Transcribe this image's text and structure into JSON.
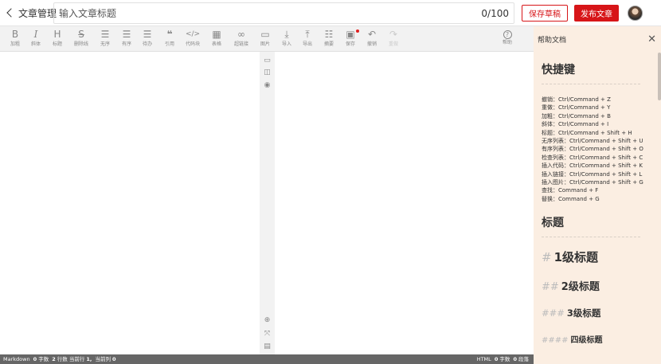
{
  "header": {
    "back_label": "文章管理",
    "title_placeholder": "输入文章标题",
    "title_value": "",
    "counter": "0/100",
    "save_draft_label": "保存草稿",
    "publish_label": "发布文章"
  },
  "toolbar": {
    "items": [
      {
        "glyph": "B",
        "label": "加粗"
      },
      {
        "glyph": "I",
        "label": "斜体"
      },
      {
        "glyph": "H",
        "label": "标题"
      },
      {
        "glyph": "S",
        "label": "删除线"
      },
      {
        "glyph": "☰",
        "label": "无序"
      },
      {
        "glyph": "☰",
        "label": "有序"
      },
      {
        "glyph": "☰",
        "label": "待办"
      },
      {
        "glyph": "❝",
        "label": "引用"
      },
      {
        "glyph": "</>",
        "label": "代码块"
      },
      {
        "glyph": "▦",
        "label": "表格"
      },
      {
        "glyph": "∞",
        "label": "超链接"
      },
      {
        "glyph": "▭",
        "label": "图片"
      },
      {
        "glyph": "⤓",
        "label": "导入"
      },
      {
        "glyph": "⤒",
        "label": "导出"
      },
      {
        "glyph": "☷",
        "label": "摘要"
      },
      {
        "glyph": "▣",
        "label": "保存"
      },
      {
        "glyph": "↶",
        "label": "撤销"
      },
      {
        "glyph": "↷",
        "label": "重做"
      },
      {
        "glyph": "?",
        "label": "帮助"
      }
    ]
  },
  "statusbar": {
    "left_mode": "Markdown",
    "left_words_num": "0",
    "left_words_label": "字数",
    "left_lines_num": "2",
    "left_lines_label": "行数",
    "left_cursor_label": "当前行",
    "left_cursor_row": "1,",
    "left_cursor_col_label": "当前列",
    "left_cursor_col": "0",
    "right_mode": "HTML",
    "right_words_num": "0",
    "right_words_label": "字数",
    "right_para_num": "0",
    "right_para_label": "段落"
  },
  "help": {
    "title": "帮助文档",
    "shortcuts_heading": "快捷键",
    "shortcuts": [
      "撤销：Ctrl/Command + Z",
      "重做：Ctrl/Command + Y",
      "加粗：Ctrl/Command + B",
      "斜体：Ctrl/Command + I",
      "标题：Ctrl/Command + Shift + H",
      "无序列表：Ctrl/Command + Shift + U",
      "有序列表：Ctrl/Command + Shift + O",
      "检查列表：Ctrl/Command + Shift + C",
      "插入代码：Ctrl/Command + Shift + K",
      "插入链接：Ctrl/Command + Shift + L",
      "插入图片：Ctrl/Command + Shift + G",
      "查找：Command + F",
      "替换：Command + G"
    ],
    "headings_heading": "标题",
    "h1": {
      "tag": "#",
      "text": "1级标题"
    },
    "h2": {
      "tag": "##",
      "text": "2级标题"
    },
    "h3": {
      "tag": "###",
      "text": "3级标题"
    },
    "h4": {
      "tag": "####",
      "text": "四级标题"
    }
  },
  "colors": {
    "brand_red": "#d71518",
    "help_bg": "#fbeee2",
    "toolbar_bg": "#f2f2f2",
    "statusbar_bg": "#666666"
  }
}
